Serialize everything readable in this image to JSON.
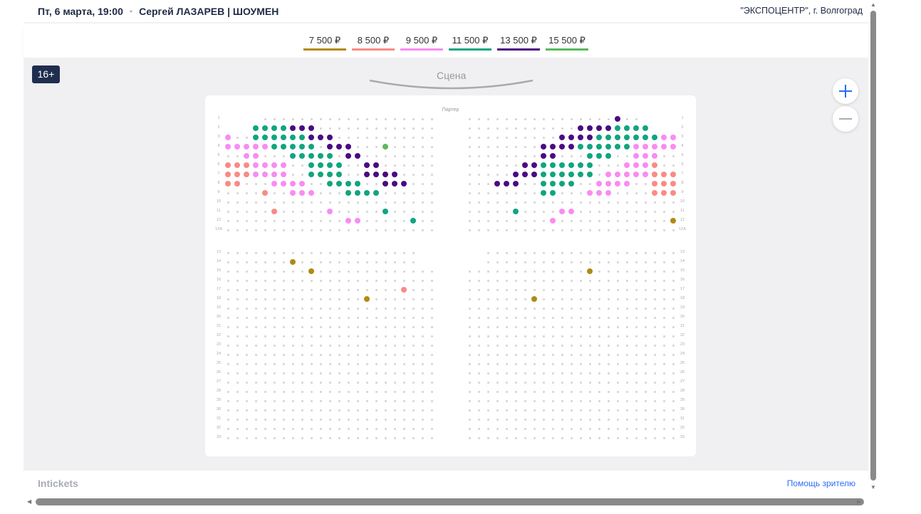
{
  "header": {
    "date": "Пт, 6 марта, 19:00",
    "separator": "•",
    "title": "Сергей ЛАЗАРЕВ | ШОУМЕН",
    "venue": "\"ЭКСПОЦЕНТР\", г. Волгоград"
  },
  "legend": [
    {
      "code": "O",
      "label": "7 500 ₽",
      "color": "#b08a12"
    },
    {
      "code": "S",
      "label": "8 500 ₽",
      "color": "#f98b84"
    },
    {
      "code": "K",
      "label": "9 500 ₽",
      "color": "#f98cf3"
    },
    {
      "code": "T",
      "label": "11 500 ₽",
      "color": "#10a57f"
    },
    {
      "code": "P",
      "label": "13 500 ₽",
      "color": "#4a0a82"
    },
    {
      "code": "G",
      "label": "15 500 ₽",
      "color": "#5cb85c"
    }
  ],
  "map": {
    "age_badge": "16+",
    "stage_label": "Сцена",
    "section_label": "Партер",
    "zoom_in": "+",
    "zoom_out": "−"
  },
  "seat_legend_codes": {
    ".": "unavailable",
    " ": "no seat"
  },
  "seating": {
    "upper": [
      {
        "row": "1",
        "left": "    ...................",
        "right": "................P..    "
      },
      {
        "row": "2",
        "left": "   TTTTPPP.............",
        "right": "............PPPPTTTT   "
      },
      {
        "row": "3",
        "left": "K..TTTTTTPPP...........",
        "right": "..........PPPPTTTTTTTKK"
      },
      {
        "row": "4",
        "left": "KKKKKTTTTT.PPP...G.....",
        "right": "........PPPPTTTTTTKKKKK"
      },
      {
        "row": "5",
        "left": "..KK...TTTTT.PP........",
        "right": "........PP...TTT..KKK.."
      },
      {
        "row": "6",
        "left": "SSSKKKK..TTTT..PP......",
        "right": "......PPTTTTTT...KKKS.."
      },
      {
        "row": "7",
        "left": "SSSKKKK..TTTT..PPPP....",
        "right": ".....PPPTTTTTT.KKKKKSSS"
      },
      {
        "row": "8",
        "left": "SS...KKKK..TTTT..PPP...",
        "right": "...PPP..TTTT..KKKK..SSS"
      },
      {
        "row": "9",
        "left": "....S..KKK...TTTT......",
        "right": "........TT...KKK....SSS"
      },
      {
        "row": "10",
        "left": ".......................",
        "right": "......................."
      },
      {
        "row": "11",
        "left": ".....S.....K.....T.....",
        "right": ".....T....KK..........."
      },
      {
        "row": "12",
        "left": ".............KK.....T..",
        "right": ".........K............O"
      },
      {
        "row": "12A",
        "left": ".......................",
        "right": "......................."
      }
    ],
    "lower": [
      {
        "row": "13",
        "left": ".....................  ",
        "right": "  ....................."
      },
      {
        "row": "14",
        "left": ".......O.............  ",
        "right": "  ....................."
      },
      {
        "row": "15",
        "left": ".........O.............",
        "right": ".............O........."
      },
      {
        "row": "16",
        "left": ".......................",
        "right": "......................."
      },
      {
        "row": "17",
        "left": "...................S...",
        "right": "......................."
      },
      {
        "row": "18",
        "left": "...............O.......",
        "right": ".......O..............."
      },
      {
        "row": "19",
        "left": ".......................",
        "right": "......................."
      },
      {
        "row": "20",
        "left": ".......................",
        "right": "......................."
      },
      {
        "row": "21",
        "left": ".......................",
        "right": "......................."
      },
      {
        "row": "22",
        "left": ".......................",
        "right": "......................."
      },
      {
        "row": "23",
        "left": ".......................",
        "right": "......................."
      },
      {
        "row": "24",
        "left": ".......................",
        "right": "......................."
      },
      {
        "row": "25",
        "left": ".......................",
        "right": "......................."
      },
      {
        "row": "26",
        "left": ".......................",
        "right": "......................."
      },
      {
        "row": "27",
        "left": ".......................",
        "right": "......................."
      },
      {
        "row": "28",
        "left": ".......................",
        "right": "......................."
      },
      {
        "row": "29",
        "left": ".......................",
        "right": "......................."
      },
      {
        "row": "30",
        "left": ".......................",
        "right": "......................."
      },
      {
        "row": "31",
        "left": ".......................",
        "right": "......................."
      },
      {
        "row": "32",
        "left": ".......................",
        "right": "......................."
      },
      {
        "row": "33",
        "left": ".......................",
        "right": "......................."
      }
    ]
  },
  "footer": {
    "logo": "Intickets",
    "help_link": "Помощь зрителю"
  }
}
